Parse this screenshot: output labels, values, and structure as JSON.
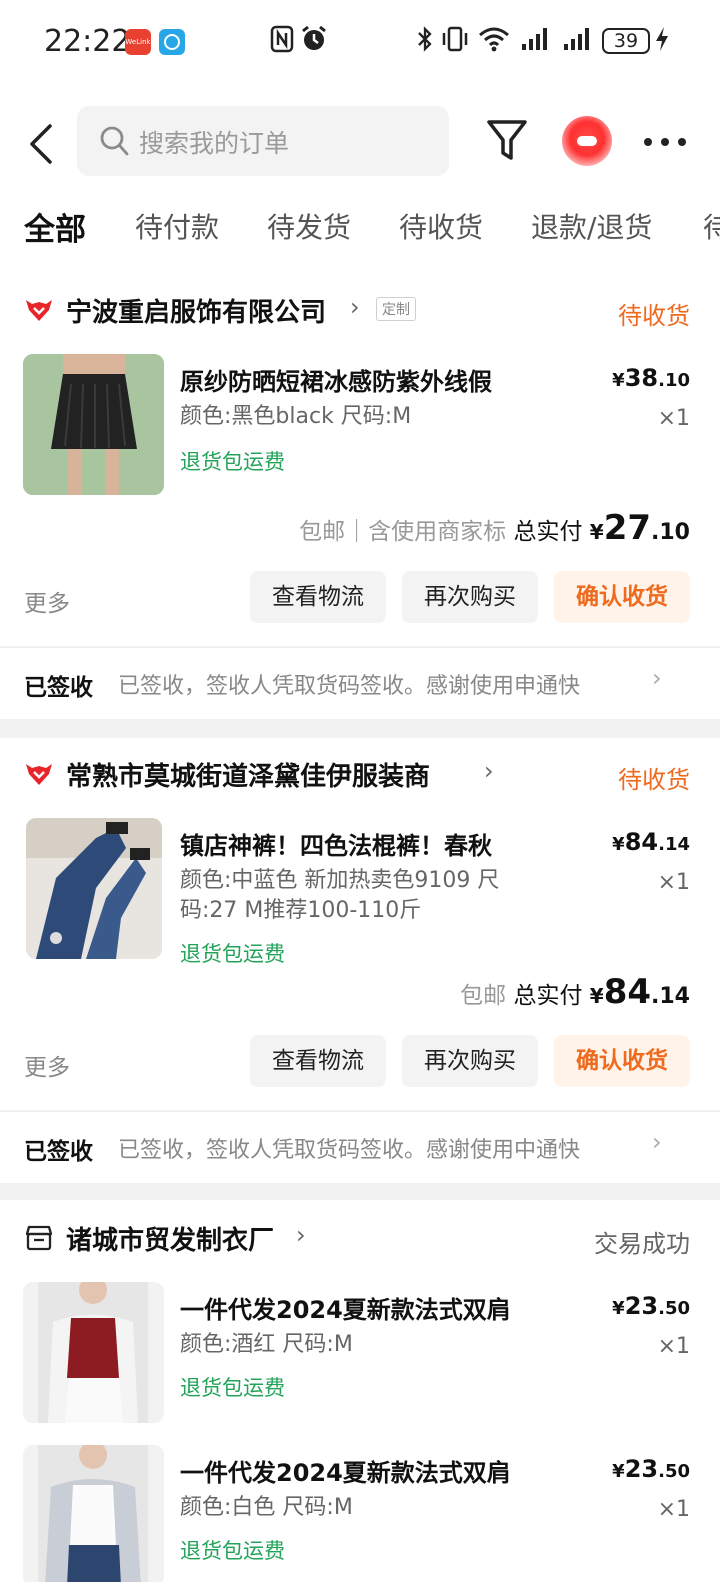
{
  "status_bar": {
    "time": "22:22",
    "badge_welink": "WeLink",
    "battery": "39"
  },
  "header": {
    "search_placeholder": "搜索我的订单"
  },
  "tabs": [
    "全部",
    "待付款",
    "待发货",
    "待收货",
    "退款/退货",
    "待"
  ],
  "orders": [
    {
      "shop": "宁波重启服饰有限公司",
      "tag": "定制",
      "status": "待收货",
      "items": [
        {
          "title": "原纱防晒短裙冰感防紫外线假",
          "spec": "颜色:黑色black 尺码:M",
          "return_note": "退货包运费",
          "price_currency": "¥",
          "price_int": "38",
          "price_dec": ".10",
          "qty": "×1"
        }
      ],
      "summary_note": "包邮｜含使用商家标",
      "total_label": "总实付",
      "total_currency": "¥",
      "total_int": "27",
      "total_dec": ".10",
      "more": "更多",
      "btn_logistics": "查看物流",
      "btn_rebuy": "再次购买",
      "btn_confirm": "确认收货",
      "logistics_title": "已签收",
      "logistics_detail": "已签收，签收人凭取货码签收。感谢使用申通快"
    },
    {
      "shop": "常熟市莫城街道泽黛佳伊服装商",
      "status": "待收货",
      "items": [
        {
          "title": "镇店神裤！四色法棍裤！春秋",
          "spec": "颜色:中蓝色 新加热卖色9109 尺码:27 M推荐100-110斤",
          "return_note": "退货包运费",
          "price_currency": "¥",
          "price_int": "84",
          "price_dec": ".14",
          "qty": "×1"
        }
      ],
      "summary_note": "包邮",
      "total_label": "总实付",
      "total_currency": "¥",
      "total_int": "84",
      "total_dec": ".14",
      "more": "更多",
      "btn_logistics": "查看物流",
      "btn_rebuy": "再次购买",
      "btn_confirm": "确认收货",
      "logistics_title": "已签收",
      "logistics_detail": "已签收，签收人凭取货码签收。感谢使用中通快"
    },
    {
      "shop": "诸城市贸发制衣厂",
      "status": "交易成功",
      "items": [
        {
          "title": "一件代发2024夏新款法式双肩",
          "spec": "颜色:酒红 尺码:M",
          "return_note": "退货包运费",
          "price_currency": "¥",
          "price_int": "23",
          "price_dec": ".50",
          "qty": "×1"
        },
        {
          "title": "一件代发2024夏新款法式双肩",
          "spec": "颜色:白色 尺码:M",
          "return_note": "退货包运费",
          "price_currency": "¥",
          "price_int": "23",
          "price_dec": ".50",
          "qty": "×1"
        }
      ]
    }
  ],
  "colors": {
    "accent_orange": "#f06a1e",
    "return_green": "#23a35a",
    "shop_red": "#e8262a"
  }
}
